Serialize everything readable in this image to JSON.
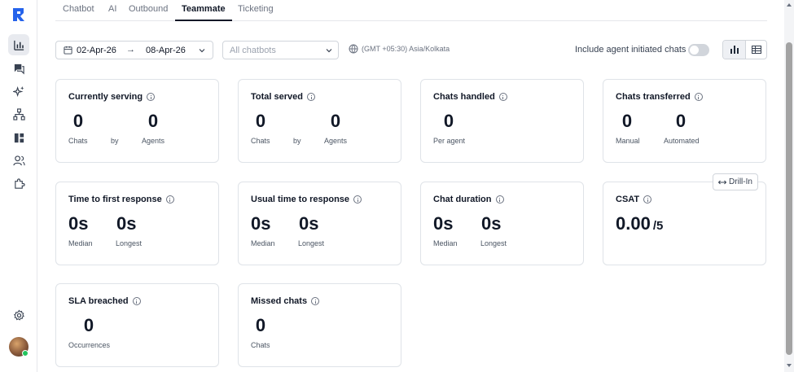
{
  "colors": {
    "accent": "#2563eb",
    "online": "#22c55e",
    "border": "#dfe3e8",
    "text_primary": "#111827",
    "text_muted": "#6b7280"
  },
  "sidebar": {
    "logo_icon": "app-logo-icon",
    "items": [
      {
        "icon": "analytics-icon",
        "active": true
      },
      {
        "icon": "chat-icon",
        "active": false
      },
      {
        "icon": "ai-sparkle-icon",
        "active": false
      },
      {
        "icon": "hierarchy-icon",
        "active": false
      },
      {
        "icon": "kanban-icon",
        "active": false
      },
      {
        "icon": "users-icon",
        "active": false
      },
      {
        "icon": "integrations-icon",
        "active": false
      }
    ],
    "settings_icon": "settings-icon",
    "avatar_status": "online"
  },
  "tabs": [
    {
      "label": "Chatbot",
      "active": false
    },
    {
      "label": "AI",
      "active": false
    },
    {
      "label": "Outbound",
      "active": false
    },
    {
      "label": "Teammate",
      "active": true
    },
    {
      "label": "Ticketing",
      "active": false
    }
  ],
  "filters": {
    "date_start": "02-Apr-26",
    "date_arrow": "→",
    "date_end": "08-Apr-26",
    "chatbot_placeholder": "All chatbots",
    "timezone": "(GMT +05:30) Asia/Kolkata",
    "include_agent_label": "Include agent initiated chats",
    "include_agent_enabled": false,
    "view_mode": "chart"
  },
  "cards": {
    "currently_serving": {
      "title": "Currently serving",
      "chats": "0",
      "chats_label": "Chats",
      "by": "by",
      "agents": "0",
      "agents_label": "Agents"
    },
    "total_served": {
      "title": "Total served",
      "chats": "0",
      "chats_label": "Chats",
      "by": "by",
      "agents": "0",
      "agents_label": "Agents"
    },
    "chats_handled": {
      "title": "Chats handled",
      "value": "0",
      "label": "Per agent"
    },
    "chats_transferred": {
      "title": "Chats transferred",
      "manual": "0",
      "manual_label": "Manual",
      "automated": "0",
      "automated_label": "Automated"
    },
    "time_first_response": {
      "title": "Time to first response",
      "median": "0s",
      "median_label": "Median",
      "longest": "0s",
      "longest_label": "Longest"
    },
    "usual_time_response": {
      "title": "Usual time to response",
      "median": "0s",
      "median_label": "Median",
      "longest": "0s",
      "longest_label": "Longest"
    },
    "chat_duration": {
      "title": "Chat duration",
      "median": "0s",
      "median_label": "Median",
      "longest": "0s",
      "longest_label": "Longest"
    },
    "csat": {
      "title": "CSAT",
      "value": "0.00",
      "max": "/5",
      "drill_label": "Drill-In"
    },
    "sla_breached": {
      "title": "SLA breached",
      "value": "0",
      "label": "Occurrences"
    },
    "missed_chats": {
      "title": "Missed chats",
      "value": "0",
      "label": "Chats"
    }
  }
}
